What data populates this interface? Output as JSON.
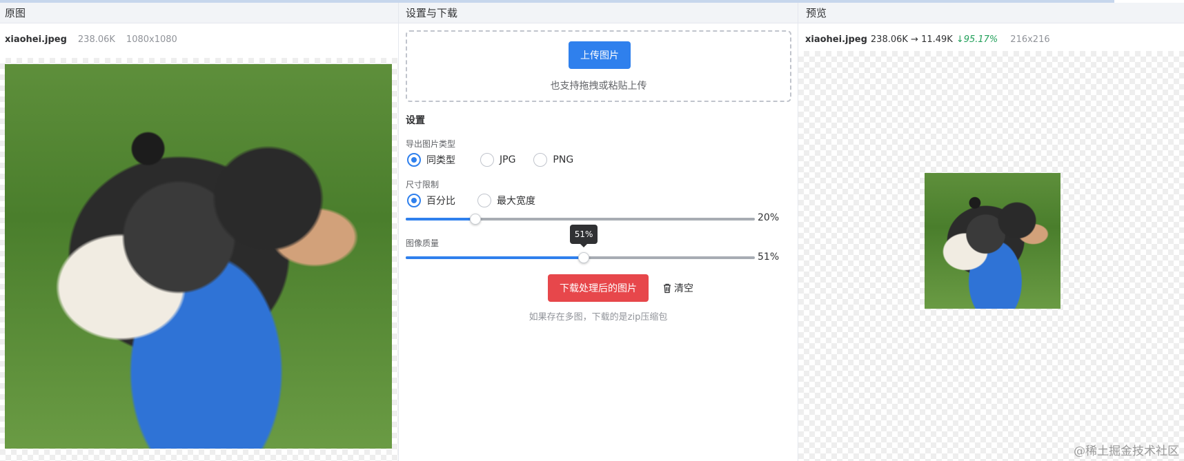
{
  "panels": {
    "original": {
      "title": "原图",
      "file_name": "xiaohei.jpeg",
      "file_size": "238.06K",
      "dimensions": "1080x1080"
    },
    "settings": {
      "title": "设置与下载",
      "upload_label": "上传图片",
      "upload_hint": "也支持拖拽或粘贴上传",
      "section_title": "设置",
      "export_type": {
        "label": "导出图片类型",
        "options": [
          "同类型",
          "JPG",
          "PNG"
        ],
        "selected": "同类型"
      },
      "size_limit": {
        "label": "尺寸限制",
        "options": [
          "百分比",
          "最大宽度"
        ],
        "selected": "百分比",
        "value": 20,
        "value_label": "20%"
      },
      "quality": {
        "label": "图像质量",
        "value": 51,
        "value_label": "51%",
        "tooltip": "51%"
      },
      "download_label": "下载处理后的图片",
      "clear_label": "清空",
      "download_hint": "如果存在多图，下载的是zip压缩包"
    },
    "preview": {
      "title": "预览",
      "file_name": "xiaohei.jpeg",
      "size_change": "238.06K → 11.49K",
      "reduction": "↓95.17%",
      "dimensions": "216x216"
    }
  },
  "watermark": "@稀土掘金技术社区",
  "icons": {
    "clear": "trash-icon"
  },
  "colors": {
    "primary": "#2f80ed",
    "danger": "#e7474b",
    "reduction": "#22a05a"
  }
}
